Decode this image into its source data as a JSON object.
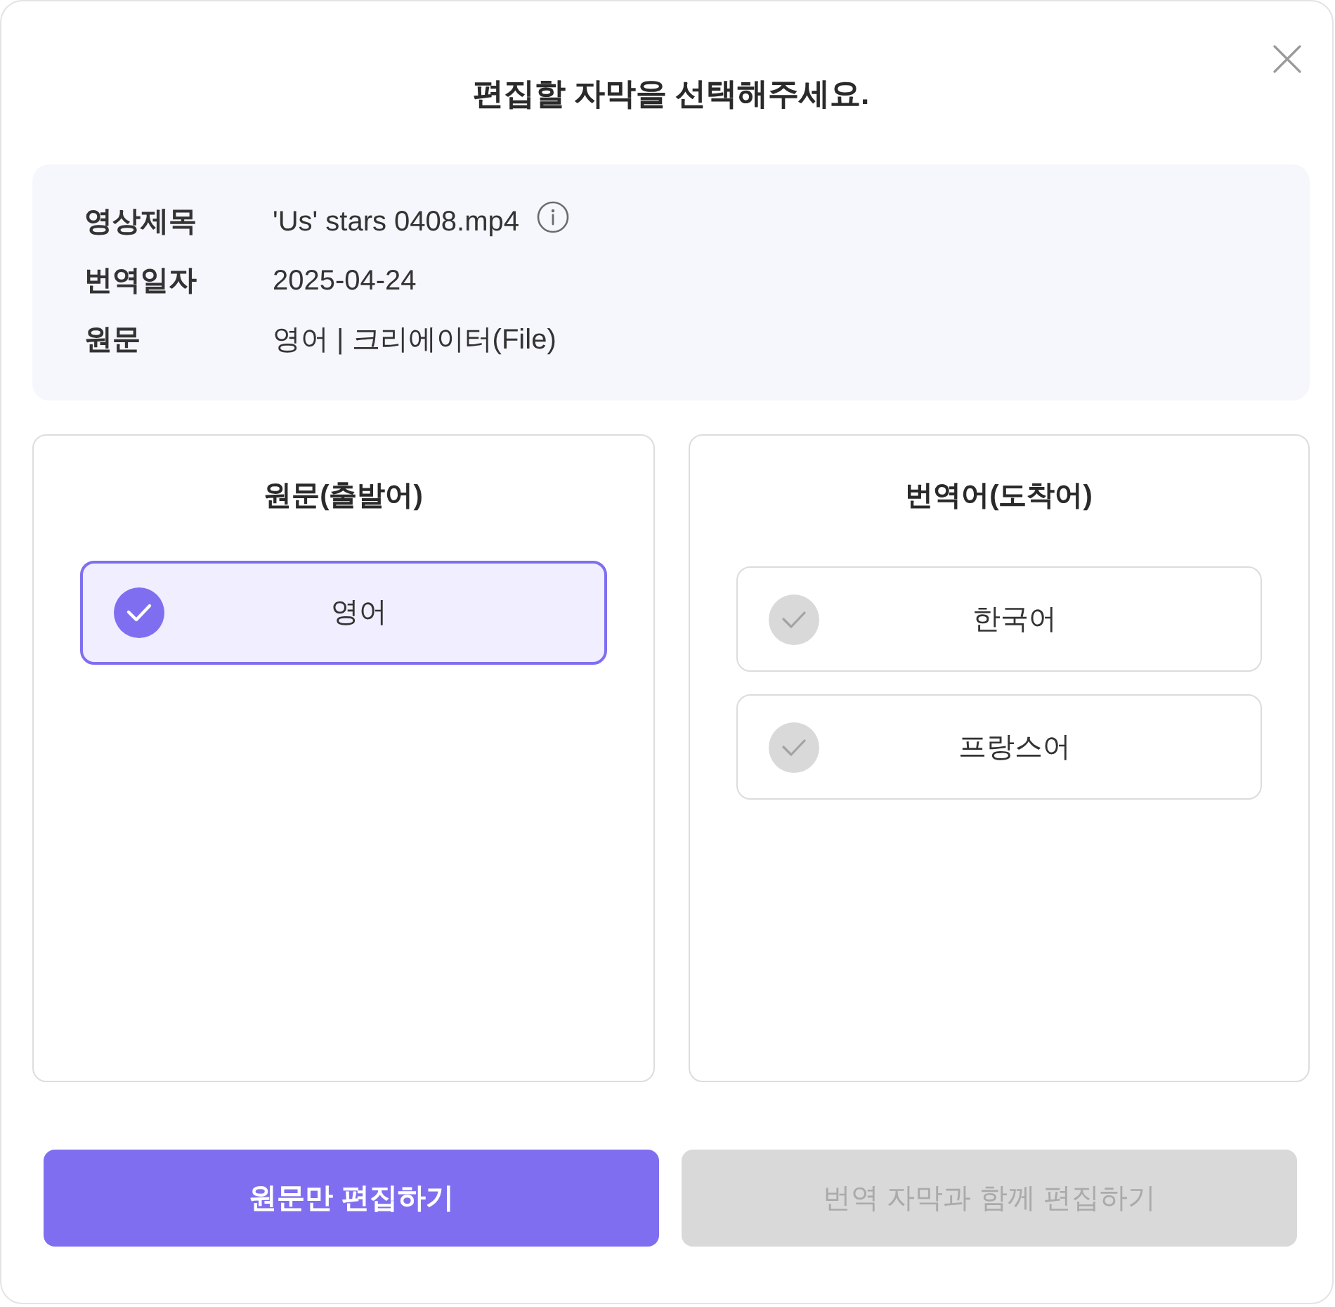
{
  "dialog": {
    "title": "편집할 자막을 선택해주세요."
  },
  "info": [
    {
      "label": "영상제목",
      "value": "'Us' stars 0408.mp4",
      "has_info": true
    },
    {
      "label": "번역일자",
      "value": "2025-04-24",
      "has_info": false
    },
    {
      "label": "원문",
      "value": "영어 | 크리에이터(File)",
      "has_info": false
    }
  ],
  "panels": [
    {
      "heading": "원문(출발어)",
      "options": [
        {
          "label": "영어",
          "selected": true
        }
      ]
    },
    {
      "heading": "번역어(도착어)",
      "options": [
        {
          "label": "한국어",
          "selected": false
        },
        {
          "label": "프랑스어",
          "selected": false
        }
      ]
    }
  ],
  "buttons": [
    {
      "label": "원문만 편집하기",
      "disabled": false
    },
    {
      "label": "번역 자막과 함께 편집하기",
      "disabled": true
    }
  ]
}
